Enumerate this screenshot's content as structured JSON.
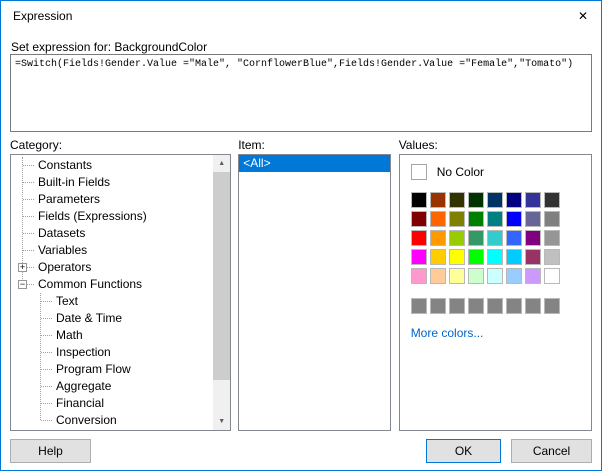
{
  "window": {
    "title": "Expression"
  },
  "icons": {
    "close": "✕",
    "expand": "+",
    "collapse": "−",
    "scroll_up": "▲",
    "scroll_down": "▼"
  },
  "expression_section": {
    "label": "Set expression for: BackgroundColor",
    "value": "=Switch(Fields!Gender.Value =\"Male\", \"CornflowerBlue\",Fields!Gender.Value =\"Female\",\"Tomato\")"
  },
  "category": {
    "label": "Category:",
    "items": [
      {
        "label": "Constants",
        "level": 1,
        "expander": ""
      },
      {
        "label": "Built-in Fields",
        "level": 1,
        "expander": ""
      },
      {
        "label": "Parameters",
        "level": 1,
        "expander": ""
      },
      {
        "label": "Fields (Expressions)",
        "level": 1,
        "expander": ""
      },
      {
        "label": "Datasets",
        "level": 1,
        "expander": ""
      },
      {
        "label": "Variables",
        "level": 1,
        "expander": ""
      },
      {
        "label": "Operators",
        "level": 1,
        "expander": "expand"
      },
      {
        "label": "Common Functions",
        "level": 1,
        "expander": "collapse"
      },
      {
        "label": "Text",
        "level": 2,
        "expander": ""
      },
      {
        "label": "Date & Time",
        "level": 2,
        "expander": ""
      },
      {
        "label": "Math",
        "level": 2,
        "expander": ""
      },
      {
        "label": "Inspection",
        "level": 2,
        "expander": ""
      },
      {
        "label": "Program Flow",
        "level": 2,
        "expander": ""
      },
      {
        "label": "Aggregate",
        "level": 2,
        "expander": ""
      },
      {
        "label": "Financial",
        "level": 2,
        "expander": ""
      },
      {
        "label": "Conversion",
        "level": 2,
        "expander": ""
      }
    ]
  },
  "item": {
    "label": "Item:",
    "entries": [
      {
        "label": "<All>",
        "selected": true
      }
    ]
  },
  "values": {
    "label": "Values:",
    "no_color": "No Color",
    "more_colors": "More colors...",
    "palette_rows": [
      [
        "#000000",
        "#993300",
        "#333300",
        "#003300",
        "#003366",
        "#000080",
        "#333399",
        "#333333"
      ],
      [
        "#800000",
        "#FF6600",
        "#808000",
        "#008000",
        "#008080",
        "#0000FF",
        "#666699",
        "#808080"
      ],
      [
        "#FF0000",
        "#FF9900",
        "#99CC00",
        "#339966",
        "#33CCCC",
        "#3366FF",
        "#800080",
        "#969696"
      ],
      [
        "#FF00FF",
        "#FFCC00",
        "#FFFF00",
        "#00FF00",
        "#00FFFF",
        "#00CCFF",
        "#993366",
        "#C0C0C0"
      ],
      [
        "#FF99CC",
        "#FFCC99",
        "#FFFF99",
        "#CCFFCC",
        "#CCFFFF",
        "#99CCFF",
        "#CC99FF",
        "#FFFFFF"
      ]
    ],
    "custom_row": [
      "#848484",
      "#848484",
      "#848484",
      "#848484",
      "#848484",
      "#848484",
      "#848484",
      "#848484"
    ]
  },
  "buttons": {
    "help": "Help",
    "ok": "OK",
    "cancel": "Cancel"
  },
  "colors": {
    "accent": "#0078D7",
    "selection_bg": "#0078D7",
    "link": "#0066CC"
  }
}
